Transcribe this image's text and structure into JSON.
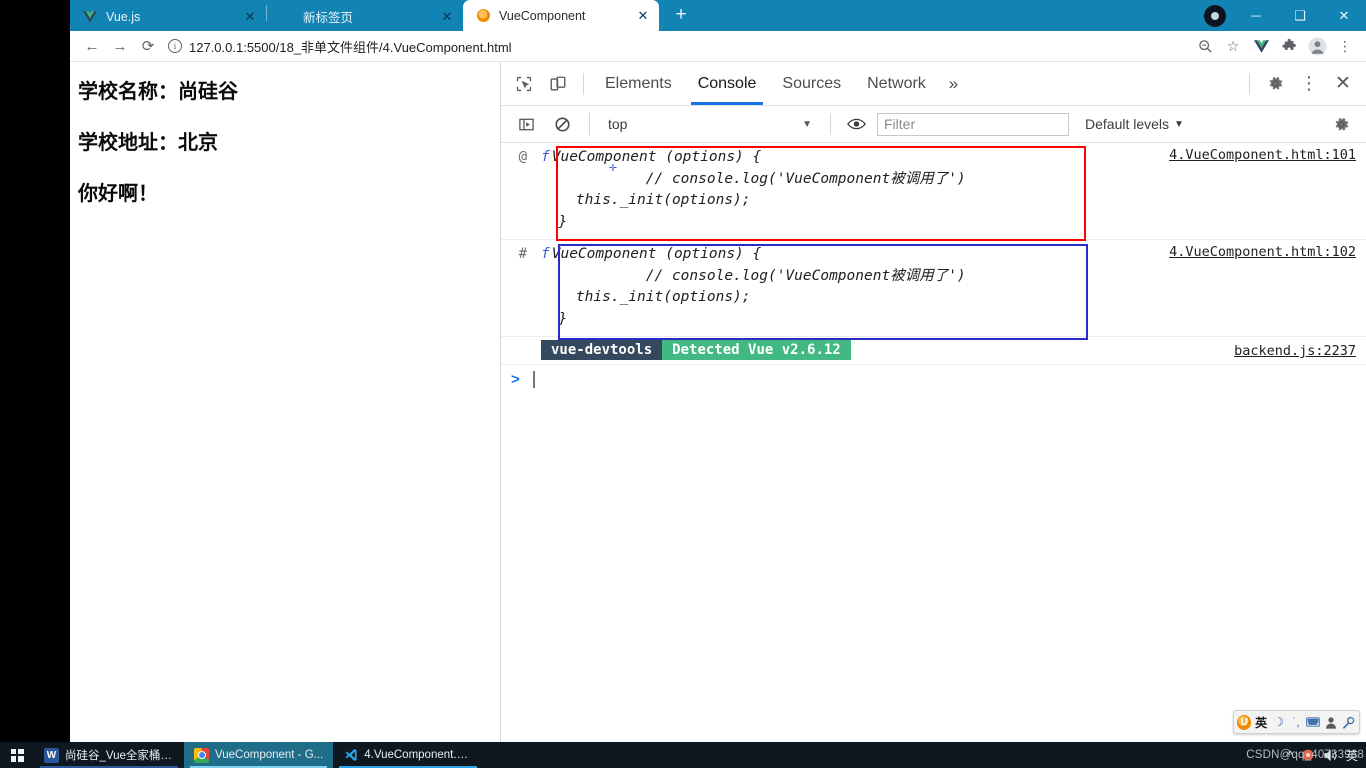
{
  "browser": {
    "tabs": [
      {
        "title": "Vue.js",
        "favicon": "vuejs-logo-icon",
        "active": false
      },
      {
        "title": "新标签页",
        "favicon": "blank-favicon",
        "active": false
      },
      {
        "title": "VueComponent",
        "favicon": "vue-devtools-logo-icon",
        "active": true
      }
    ],
    "new_tab_label": "+",
    "window_controls": {
      "minimize": "─",
      "maximize": "❑",
      "close": "✕"
    },
    "nav": {
      "back": "←",
      "forward": "→",
      "reload": "⟳"
    },
    "address_bar": {
      "url": "127.0.0.1:5500/18_非单文件组件/4.VueComponent.html",
      "info_icon": "i",
      "right_icons": [
        "zoom-icon",
        "bookmark-star-icon",
        "vue-devtools-extension-icon",
        "extensions-puzzle-icon",
        "profile-avatar-icon",
        "chrome-menu-icon"
      ]
    }
  },
  "page": {
    "lines": [
      "学校名称：尚硅谷",
      "学校地址：北京",
      "你好啊！"
    ]
  },
  "devtools": {
    "toolbar_icons": [
      "inspect-element-icon",
      "device-toolbar-icon"
    ],
    "tabs": [
      {
        "label": "Elements",
        "selected": false
      },
      {
        "label": "Console",
        "selected": true
      },
      {
        "label": "Sources",
        "selected": false
      },
      {
        "label": "Network",
        "selected": false
      }
    ],
    "more_tabs": "»",
    "right_icons": [
      "settings-gear-icon",
      "devtools-menu-icon",
      "close-devtools-icon"
    ],
    "filter_bar": {
      "sidebar_toggle": "console-sidebar-icon",
      "clear_console": "clear-console-icon",
      "context": "top",
      "context_caret": "▼",
      "eye_icon": "live-expression-eye-icon",
      "filter_placeholder": "Filter",
      "filter_value": "",
      "levels_label": "Default levels",
      "levels_caret": "▼",
      "settings_gear": "console-settings-gear-icon"
    },
    "logs": [
      {
        "marker": "@",
        "fn_keyword": "f",
        "lines": [
          "VueComponent (options) {",
          "            // console.log('VueComponent被调用了')",
          "    this._init(options);",
          "  }"
        ],
        "source": "4.VueComponent.html:101",
        "highlight_color": "#ff0000"
      },
      {
        "marker": "#",
        "fn_keyword": "f",
        "lines": [
          "VueComponent (options) {",
          "            // console.log('VueComponent被调用了')",
          "    this._init(options);",
          "  }"
        ],
        "source": "4.VueComponent.html:102",
        "highlight_color": "#2b2bc8"
      }
    ],
    "devtools_badge": {
      "left_text": "vue-devtools",
      "right_text": "Detected Vue v2.6.12",
      "left_color": "#35495e",
      "right_color": "#42b883",
      "source": "backend.js:2237"
    },
    "prompt": {
      "chevron": ">",
      "value": ""
    }
  },
  "ime_bar": {
    "items": [
      "sogou-logo-icon",
      "英",
      "moon-icon",
      "punctuation-icon",
      "soft-keyboard-icon",
      "user-icon",
      "toolbox-wrench-icon"
    ]
  },
  "taskbar": {
    "start_label": "start-windows-icon",
    "items": [
      {
        "label": "尚硅谷_Vue全家桶.d...",
        "icon": "word-icon",
        "icon_text": "W",
        "active": false,
        "underline": "#2b579a"
      },
      {
        "label": "VueComponent - G...",
        "icon": "chrome-icon",
        "icon_text": "",
        "active": true,
        "underline": "#7fd3ee"
      },
      {
        "label": "4.VueComponent.ht...",
        "icon": "vscode-icon",
        "icon_text": "⬡",
        "active": false,
        "underline": "#2aa3e8"
      }
    ],
    "tray": [
      "show-hidden-icons-chevron",
      "sogou-tray-icon",
      "volume-icon",
      "ime-english-icon"
    ],
    "watermark": "CSDN@qq_40733968"
  }
}
